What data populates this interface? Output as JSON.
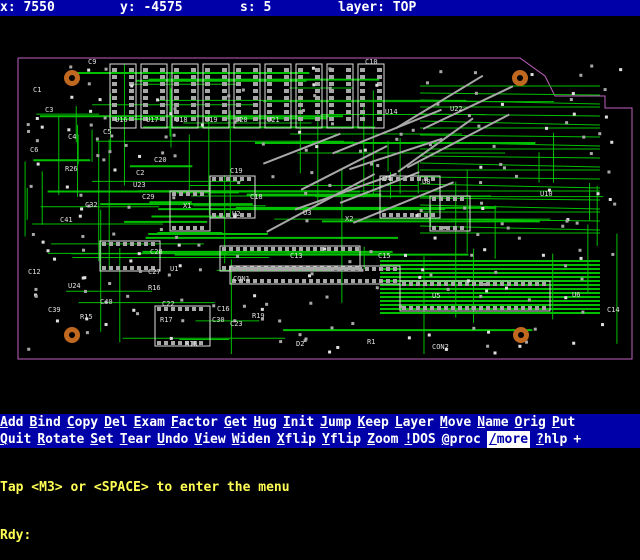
{
  "status": {
    "x": "x: 7550",
    "y": "y: -4575",
    "s": "s: 5",
    "layer": "layer: TOP"
  },
  "colors": {
    "bar_bg": "#0000a8",
    "board_outline": "#c060c0",
    "trace_green": "#00c000",
    "pad_grey": "#a8a8a8",
    "pad_copper": "#c06820",
    "silk_white": "#e0e0e0",
    "prompt_yellow": "#ffff55"
  },
  "board_labels": [
    "C9",
    "C10",
    "C1",
    "C3",
    "C4",
    "C5",
    "C6",
    "U16",
    "U17",
    "U18",
    "U19",
    "U20",
    "U21",
    "U14",
    "U22",
    "U23",
    "U4",
    "C2",
    "R26",
    "C32",
    "C41",
    "X1",
    "U2",
    "U3",
    "X2",
    "C15",
    "C13",
    "C27",
    "R16",
    "C22",
    "R17",
    "C16",
    "U1",
    "C12",
    "C30",
    "R18",
    "R19",
    "C20",
    "U24",
    "C40",
    "R15",
    "C39",
    "D2",
    "R1",
    "U5",
    "U6",
    "C14",
    "CON2",
    "CON1",
    "C19",
    "C18",
    "U8",
    "U10",
    "C28",
    "C29",
    "C23"
  ],
  "menu": {
    "row1": [
      {
        "label": "Add",
        "hot": "A"
      },
      {
        "label": "Bind",
        "hot": "B"
      },
      {
        "label": "Copy",
        "hot": "C"
      },
      {
        "label": "Del",
        "hot": "D"
      },
      {
        "label": "Exam",
        "hot": "E"
      },
      {
        "label": "Factor",
        "hot": "F"
      },
      {
        "label": "Get",
        "hot": "G"
      },
      {
        "label": "Hug",
        "hot": "H"
      },
      {
        "label": "Init",
        "hot": "I"
      },
      {
        "label": "Jump",
        "hot": "J"
      },
      {
        "label": "Keep",
        "hot": "K"
      },
      {
        "label": "Layer",
        "hot": "L"
      },
      {
        "label": "Move",
        "hot": "M"
      },
      {
        "label": "Name",
        "hot": "N"
      },
      {
        "label": "Orig",
        "hot": "O"
      },
      {
        "label": "Put",
        "hot": "P"
      }
    ],
    "row2": [
      {
        "label": "Quit",
        "hot": "Q"
      },
      {
        "label": "Rotate",
        "hot": "R"
      },
      {
        "label": "Set",
        "hot": "S"
      },
      {
        "label": "Tear",
        "hot": "T"
      },
      {
        "label": "Undo",
        "hot": "U"
      },
      {
        "label": "View",
        "hot": "V"
      },
      {
        "label": "Widen",
        "hot": "W"
      },
      {
        "label": "Xflip",
        "hot": "X"
      },
      {
        "label": "Yflip",
        "hot": "Y"
      },
      {
        "label": "Zoom",
        "hot": "Z"
      },
      {
        "label": "!DOS",
        "hot": "!"
      },
      {
        "label": "@proc",
        "hot": "@"
      },
      {
        "label": "/more",
        "hot": "/",
        "selected": true
      },
      {
        "label": "?hlp",
        "hot": "?"
      },
      {
        "label": "+",
        "hot": ""
      }
    ]
  },
  "prompt": {
    "line1": "Tap <M3> or <SPACE> to enter the menu",
    "line2": "Rdy:"
  }
}
